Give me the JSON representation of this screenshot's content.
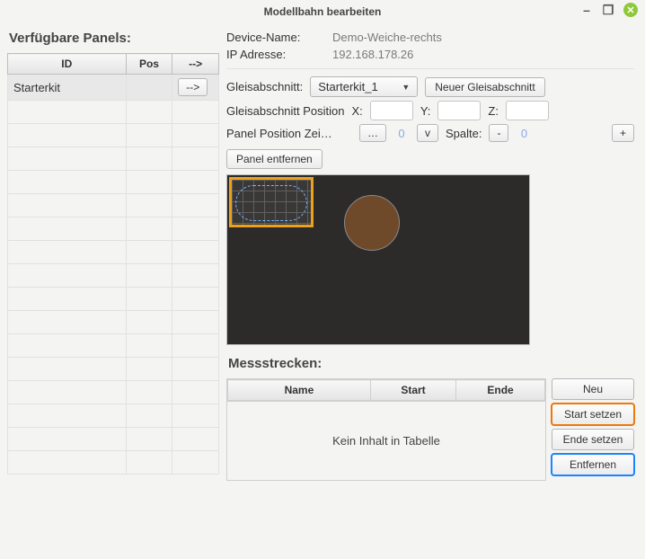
{
  "window": {
    "title": "Modellbahn bearbeiten"
  },
  "left": {
    "heading": "Verfügbare Panels:",
    "cols": {
      "id": "ID",
      "pos": "Pos",
      "go": "-->"
    },
    "rows": [
      {
        "id": "Starterkit",
        "pos": "",
        "go": "-->"
      }
    ]
  },
  "device": {
    "name_label": "Device-Name:",
    "name": "Demo-Weiche-rechts",
    "ip_label": "IP Adresse:",
    "ip": "192.168.178.26"
  },
  "section": {
    "label": "Gleisabschnitt:",
    "value": "Starterkit_1",
    "new_btn": "Neuer Gleisabschnitt",
    "pos_label": "Gleisabschnitt Position",
    "x": "X:",
    "y": "Y:",
    "z": "Z:"
  },
  "panelpos": {
    "label": "Panel Position  Zei…",
    "more": "…",
    "row_val": "0",
    "v": "v",
    "col_label": "Spalte:",
    "minus": "-",
    "col_val": "0",
    "plus": "+"
  },
  "remove_panel": "Panel entfernen",
  "mess": {
    "heading": "Messstrecken:",
    "cols": {
      "name": "Name",
      "start": "Start",
      "end": "Ende"
    },
    "empty": "Kein Inhalt in Tabelle",
    "buttons": {
      "neu": "Neu",
      "start": "Start setzen",
      "ende": "Ende setzen",
      "entfernen": "Entfernen"
    }
  }
}
